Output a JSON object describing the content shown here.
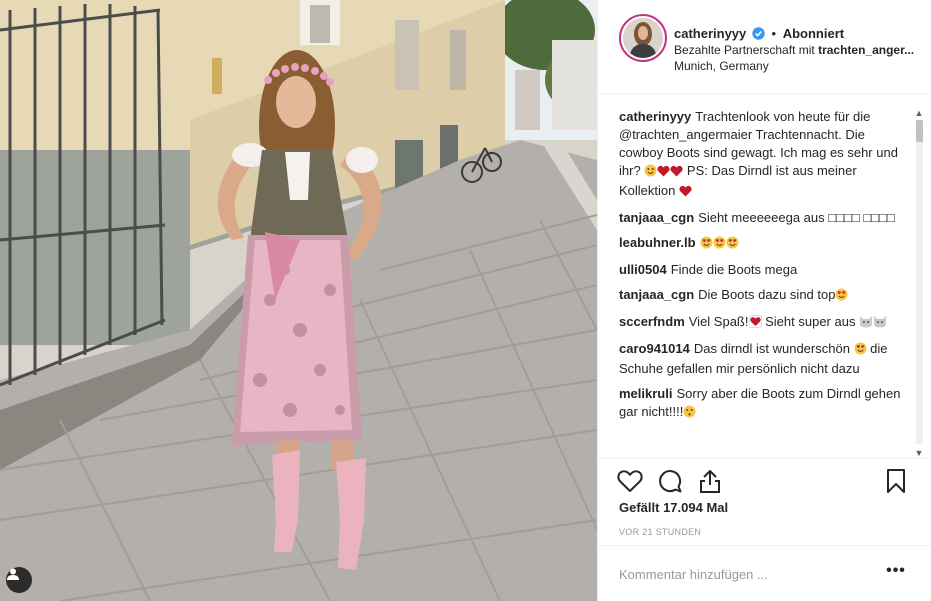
{
  "post": {
    "photo_alt": "",
    "tag_icon": "user-tag-icon"
  },
  "header": {
    "username": "catherinyyy",
    "verified_icon": "verified-badge-icon",
    "separator": "•",
    "follow_status": "Abonniert",
    "sponsor_prefix": "Bezahlte Partnerschaft mit ",
    "sponsor_name": "trachten_anger...",
    "location": "Munich, Germany"
  },
  "comments": [
    {
      "user": "catherinyyy",
      "text_a": "Trachtenlook von heute für die @trachten_angermaier Trachtennacht. Die cowboy Boots sind gewagt. Ich mag es sehr und ihr? ",
      "text_b": " PS: Das Dirndl ist aus meiner Kollektion ",
      "emoji_a": [
        "smile",
        "heart-red",
        "heart-red"
      ],
      "emoji_b": [
        "heart-red"
      ]
    },
    {
      "user": "tanjaaa_cgn",
      "text_a": "Sieht meeeeeega aus □□□□ □□□□"
    },
    {
      "user": "leabuhner.lb",
      "text_a": "",
      "emoji_a": [
        "heart-eyes",
        "heart-eyes",
        "heart-eyes"
      ]
    },
    {
      "user": "ulli0504",
      "text_a": "Finde die Boots mega"
    },
    {
      "user": "tanjaaa_cgn",
      "text_a": "Die Boots dazu sind top",
      "emoji_a": [
        "heart-eyes"
      ]
    },
    {
      "user": "sccerfndm",
      "text_a": "Viel Spaß!",
      "emoji_a": [
        "heart-box"
      ],
      "text_b": " Sieht super aus ",
      "emoji_b": [
        "cat",
        "cat"
      ]
    },
    {
      "user": "caro941014",
      "text_a": "Das dirndl ist wunderschön ",
      "emoji_a": [
        "heart-eyes"
      ],
      "text_b": " die Schuhe gefallen mir persönlich nicht dazu"
    },
    {
      "user": "melikruli",
      "text_a": "Sorry aber die Boots zum Dirndl gehen gar nicht!!!!",
      "emoji_a": [
        "flushed"
      ]
    }
  ],
  "actions": {
    "like_icon": "heart-outline-icon",
    "comment_icon": "comment-bubble-icon",
    "share_icon": "share-icon",
    "save_icon": "bookmark-icon"
  },
  "likes_text": "Gefällt 17.094 Mal",
  "time_ago": "VOR 21 STUNDEN",
  "comment_box": {
    "placeholder": "Kommentar hinzufügen ...",
    "more_label": "•••"
  },
  "colors": {
    "text": "#262626",
    "muted": "#999999",
    "verified": "#3897f0",
    "heart": "#c0192c",
    "emoji": "#f6c644"
  }
}
